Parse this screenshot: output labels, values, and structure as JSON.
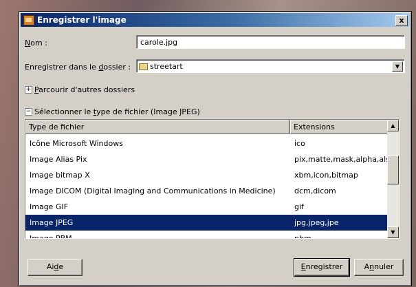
{
  "window": {
    "title": "Enregistrer l'image",
    "close_glyph": "x"
  },
  "name_field": {
    "label_u": "N",
    "label_rest": "om :",
    "value": "carole.jpg"
  },
  "folder_field": {
    "label_pre": "Enregistrer dans le ",
    "label_u": "d",
    "label_rest": "ossier :",
    "value": "streetart"
  },
  "browse": {
    "expander": "+",
    "label_u": "P",
    "label_rest": "arcourir d'autres dossiers"
  },
  "filetype_section": {
    "expander": "−",
    "label_pre": "Sélectionner le ",
    "label_u": "t",
    "label_rest": "ype de fichier (Image JPEG)"
  },
  "file_list": {
    "columns": [
      "Type de fichier",
      "Extensions"
    ],
    "rows": [
      {
        "type": "Icône Microsoft Windows",
        "ext": "ico"
      },
      {
        "type": "Image Alias Pix",
        "ext": "pix,matte,mask,alpha,als"
      },
      {
        "type": "Image bitmap X",
        "ext": "xbm,icon,bitmap"
      },
      {
        "type": "Image DICOM (Digital Imaging and Communications in Medicine)",
        "ext": "dcm,dicom"
      },
      {
        "type": "Image GIF",
        "ext": "gif"
      },
      {
        "type": "Image JPEG",
        "ext": "jpg,jpeg,jpe",
        "selected": true
      },
      {
        "type": "Image PBM",
        "ext": "pbm"
      }
    ]
  },
  "buttons": {
    "help_pre": "Ai",
    "help_u": "d",
    "help_rest": "e",
    "save_u": "E",
    "save_rest": "nregistrer",
    "cancel_pre": "A",
    "cancel_u": "n",
    "cancel_rest": "nuler"
  },
  "icons": {
    "title": "gimp-wilber-icon",
    "folder": "folder-icon",
    "scroll_up": "arrow-up-icon",
    "scroll_down": "arrow-down-icon",
    "combo": "chevron-down-icon"
  },
  "colors": {
    "titlebar": "#0a246a",
    "selection": "#0a246a",
    "dialog_bg": "#d4d0c8"
  }
}
